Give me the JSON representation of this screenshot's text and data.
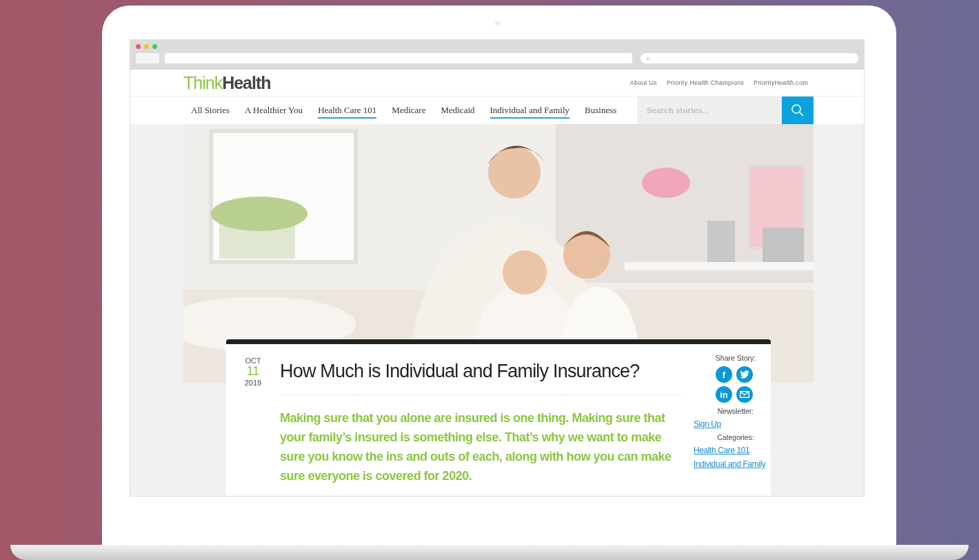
{
  "browser": {
    "search_icon": "⌕"
  },
  "site": {
    "logo": {
      "first": "Think",
      "second": "Health"
    },
    "top_links": [
      "About Us",
      "Priority Health Champions",
      "PriorityHealth.com"
    ],
    "nav": [
      {
        "label": "All Stories",
        "selected": false
      },
      {
        "label": "A Healthier You",
        "selected": false
      },
      {
        "label": "Health Care 101",
        "selected": true
      },
      {
        "label": "Medicare",
        "selected": false
      },
      {
        "label": "Medicaid",
        "selected": false
      },
      {
        "label": "Individual and Family",
        "selected": true
      },
      {
        "label": "Business",
        "selected": false
      }
    ],
    "search": {
      "placeholder": "Search stories..."
    }
  },
  "article": {
    "date": {
      "month": "OCT",
      "day": "11",
      "year": "2019"
    },
    "title": "How Much is Individual and Family Insurance?",
    "lead": "Making sure that you alone are insured is one thing. Making sure that your family’s insured is something else. That’s why we want to make sure you know the ins and outs of each, along with how you can make sure everyone is covered for 2020.",
    "sidebar": {
      "share_label": "Share Story:",
      "share": [
        {
          "kind": "text",
          "label": "f"
        },
        {
          "kind": "bird"
        },
        {
          "kind": "text",
          "label": "in"
        },
        {
          "kind": "mail"
        }
      ],
      "newsletter_label": "Newsletter:",
      "newsletter_link": "Sign Up",
      "categories_label": "Categories:",
      "categories": [
        "Health Care 101",
        "Individual and Family"
      ]
    }
  }
}
